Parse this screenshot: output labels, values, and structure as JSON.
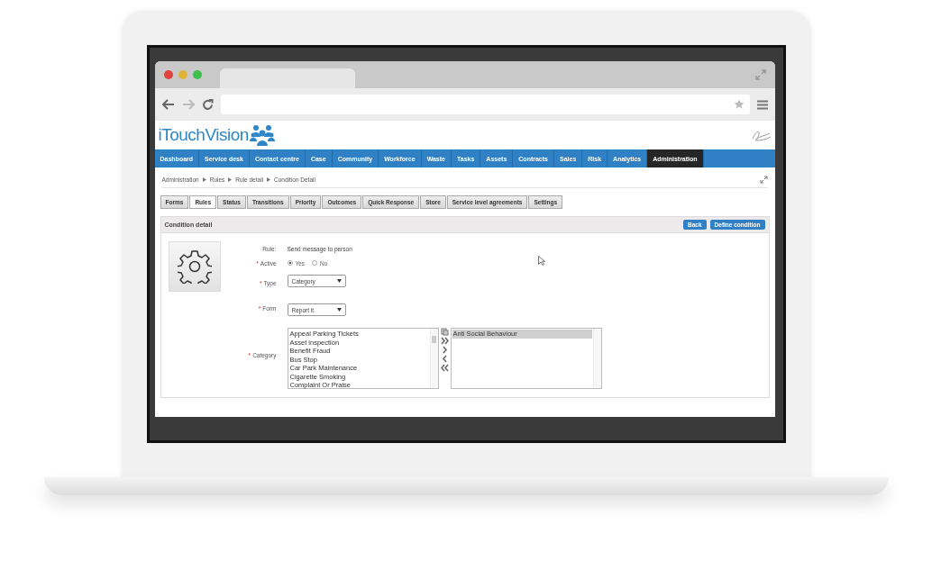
{
  "browser": {
    "nav_buttons": [
      {
        "kind": "back",
        "disabled": false
      },
      {
        "kind": "forward",
        "disabled": true
      },
      {
        "kind": "reload",
        "disabled": false
      }
    ]
  },
  "app": {
    "logo": "iTouchVision",
    "nav": [
      {
        "label": "Dashboard",
        "selected": false
      },
      {
        "label": "Service desk",
        "selected": false
      },
      {
        "label": "Contact centre",
        "selected": false
      },
      {
        "label": "Case",
        "selected": false
      },
      {
        "label": "Community",
        "selected": false
      },
      {
        "label": "Workforce",
        "selected": false
      },
      {
        "label": "Waste",
        "selected": false
      },
      {
        "label": "Tasks",
        "selected": false
      },
      {
        "label": "Assets",
        "selected": false
      },
      {
        "label": "Contracts",
        "selected": false
      },
      {
        "label": "Sales",
        "selected": false
      },
      {
        "label": "Risk",
        "selected": false
      },
      {
        "label": "Analytics",
        "selected": false
      },
      {
        "label": "Administration",
        "selected": true
      }
    ],
    "breadcrumbs": [
      "Administration",
      "Rules",
      "Rule detail",
      "Condition Detail"
    ],
    "tabs": [
      {
        "label": "Forms",
        "selected": false
      },
      {
        "label": "Rules",
        "selected": true
      },
      {
        "label": "Status",
        "selected": false
      },
      {
        "label": "Transitions",
        "selected": false
      },
      {
        "label": "Priority",
        "selected": false
      },
      {
        "label": "Outcomes",
        "selected": false
      },
      {
        "label": "Quick Response",
        "selected": false
      },
      {
        "label": "Store",
        "selected": false
      },
      {
        "label": "Service level agreements",
        "selected": false
      },
      {
        "label": "Settings",
        "selected": false
      }
    ],
    "panel": {
      "title": "Condition detail",
      "buttons": [
        "Back",
        "Define condition"
      ],
      "fields": [
        {
          "kind": "text",
          "label": "Rule:",
          "value": "Send message to person"
        },
        {
          "kind": "radio",
          "required_mark": "*",
          "label": "Active",
          "options": [
            {
              "label": "Yes",
              "selected": true
            },
            {
              "label": "No",
              "selected": false
            }
          ]
        },
        {
          "kind": "select",
          "required_mark": "*",
          "label": "Type",
          "value": "Category"
        },
        {
          "kind": "select",
          "required_mark": "*",
          "label": "Form",
          "value": "Report it"
        },
        {
          "kind": "transfer",
          "required_mark": "*",
          "label": "Category",
          "available": [
            "Appeal Parking Tickets",
            "Asset inspection",
            "Benefit Fraud",
            "Bus Stop",
            "Car Park Maintenance",
            "Cigarette Smoking",
            "Complaint Or Praise"
          ],
          "chosen": [
            {
              "label": "Anti Social Behaviour",
              "selected": true
            }
          ]
        }
      ]
    }
  }
}
